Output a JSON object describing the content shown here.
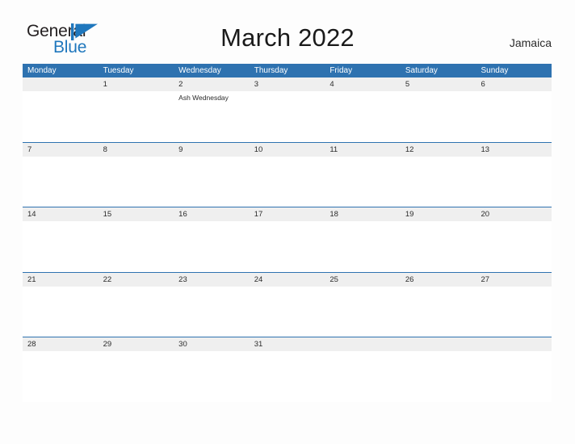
{
  "brand": {
    "name_part1": "General",
    "name_part2": "Blue",
    "flag_icon": "blue-flag-triangle",
    "color_dark": "#231f20",
    "color_blue": "#1f77bd"
  },
  "header": {
    "title": "March 2022",
    "country": "Jamaica"
  },
  "theme": {
    "header_blue": "#2e72b0",
    "date_band_gray": "#efefef",
    "page_background": "#fdfdfd",
    "text_dark": "#2b2b2b"
  },
  "calendar": {
    "month": "March",
    "year": "2022",
    "weekday_headers": [
      "Monday",
      "Tuesday",
      "Wednesday",
      "Thursday",
      "Friday",
      "Saturday",
      "Sunday"
    ],
    "weeks": [
      [
        {
          "date": "",
          "events": []
        },
        {
          "date": "1",
          "events": []
        },
        {
          "date": "2",
          "events": [
            "Ash Wednesday"
          ]
        },
        {
          "date": "3",
          "events": []
        },
        {
          "date": "4",
          "events": []
        },
        {
          "date": "5",
          "events": []
        },
        {
          "date": "6",
          "events": []
        }
      ],
      [
        {
          "date": "7",
          "events": []
        },
        {
          "date": "8",
          "events": []
        },
        {
          "date": "9",
          "events": []
        },
        {
          "date": "10",
          "events": []
        },
        {
          "date": "11",
          "events": []
        },
        {
          "date": "12",
          "events": []
        },
        {
          "date": "13",
          "events": []
        }
      ],
      [
        {
          "date": "14",
          "events": []
        },
        {
          "date": "15",
          "events": []
        },
        {
          "date": "16",
          "events": []
        },
        {
          "date": "17",
          "events": []
        },
        {
          "date": "18",
          "events": []
        },
        {
          "date": "19",
          "events": []
        },
        {
          "date": "20",
          "events": []
        }
      ],
      [
        {
          "date": "21",
          "events": []
        },
        {
          "date": "22",
          "events": []
        },
        {
          "date": "23",
          "events": []
        },
        {
          "date": "24",
          "events": []
        },
        {
          "date": "25",
          "events": []
        },
        {
          "date": "26",
          "events": []
        },
        {
          "date": "27",
          "events": []
        }
      ],
      [
        {
          "date": "28",
          "events": []
        },
        {
          "date": "29",
          "events": []
        },
        {
          "date": "30",
          "events": []
        },
        {
          "date": "31",
          "events": []
        },
        {
          "date": "",
          "events": []
        },
        {
          "date": "",
          "events": []
        },
        {
          "date": "",
          "events": []
        }
      ]
    ]
  }
}
